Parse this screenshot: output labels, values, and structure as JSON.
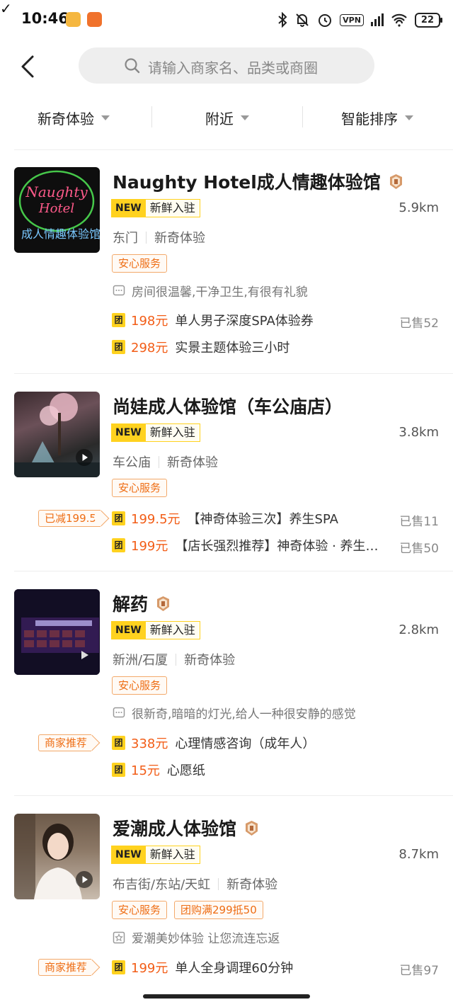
{
  "status_bar": {
    "time": "10:46",
    "vpn": "VPN",
    "battery": "22"
  },
  "search": {
    "placeholder": "请输入商家名、品类或商圈"
  },
  "filters": [
    "新奇体验",
    "附近",
    "智能排序"
  ],
  "colors": {
    "accent": "#f25d17",
    "tag_yellow": "#ffd21f",
    "badge_border": "#f3a96b"
  },
  "tags": {
    "new": "NEW",
    "fresh": "新鲜入驻"
  },
  "shops": [
    {
      "name": "Naughty Hotel成人情趣体验馆",
      "distance": "5.9km",
      "area": "东门",
      "category": "新奇体验",
      "badges": [
        "安心服务"
      ],
      "review": "房间很温馨,干净卫生,有很有礼貌",
      "thumb_text": [
        "Naughty",
        "Hotel",
        "成人情趣体验馆"
      ],
      "deals": [
        {
          "price": "198元",
          "name": "单人男子深度SPA体验券",
          "sold": "已售52"
        },
        {
          "price": "298元",
          "name": "实景主题体验三小时",
          "sold": ""
        }
      ]
    },
    {
      "name": "尚娃成人体验馆（车公庙店）",
      "distance": "3.8km",
      "area": "车公庙",
      "category": "新奇体验",
      "badges": [
        "安心服务"
      ],
      "promo": "已减199.5",
      "deals": [
        {
          "price": "199.5元",
          "name": "【神奇体验三次】养生SPA",
          "sold": "已售11"
        },
        {
          "price": "199元",
          "name": "【店长强烈推荐】神奇体验 · 养生SPA",
          "sold": "已售50"
        }
      ]
    },
    {
      "name": "解药",
      "distance": "2.8km",
      "area": "新洲/石厦",
      "category": "新奇体验",
      "badges": [
        "安心服务"
      ],
      "review": "很新奇,暗暗的灯光,给人一种很安静的感觉",
      "promo": "商家推荐",
      "deals": [
        {
          "price": "338元",
          "name": "心理情感咨询（成年人）",
          "sold": ""
        },
        {
          "price": "15元",
          "name": "心愿纸",
          "sold": ""
        }
      ]
    },
    {
      "name": "爱潮成人体验馆",
      "distance": "8.7km",
      "area": "布吉街/东站/天虹",
      "category": "新奇体验",
      "badges": [
        "安心服务",
        "团购满299抵50"
      ],
      "review": "爱潮美妙体验 让您流连忘返",
      "promo": "商家推荐",
      "deals": [
        {
          "price": "199元",
          "name": "单人全身调理60分钟",
          "sold": "已售97"
        }
      ]
    }
  ],
  "tuan_label": "团"
}
